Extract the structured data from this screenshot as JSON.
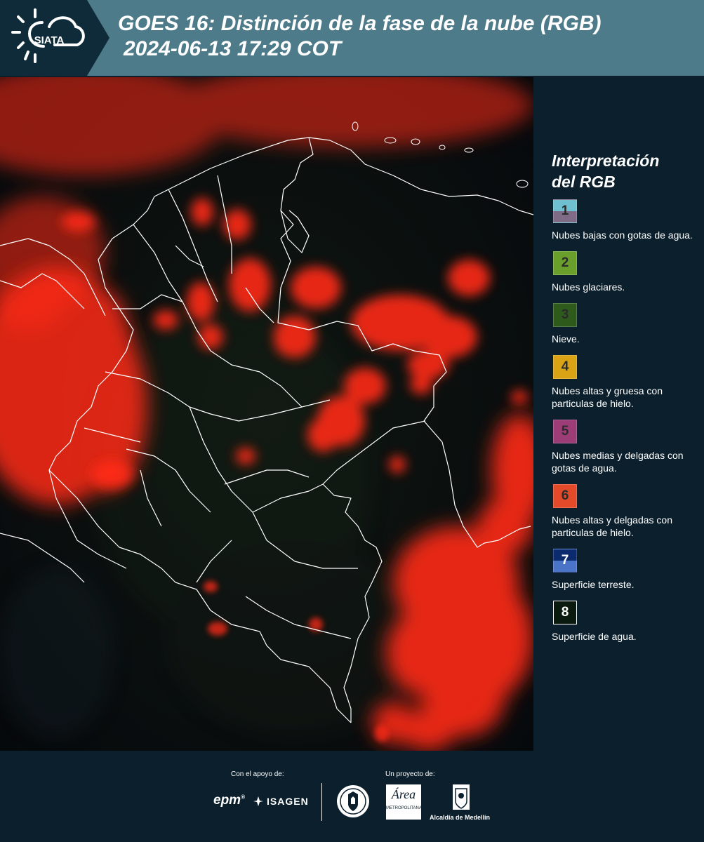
{
  "header": {
    "logo_text": "SIATA",
    "title_line1": "GOES 16: Distinción de la fase de la nube (RGB)",
    "title_line2": "2024-06-13 17:29 COT"
  },
  "legend": {
    "title_line1": "Interpretación",
    "title_line2": "del RGB",
    "items": [
      {
        "number": "1",
        "label": "Nubes bajas con gotas de agua.",
        "color_top": "#6ebfcf",
        "color_bottom": "#7f6b86"
      },
      {
        "number": "2",
        "label": "Nubes glaciares.",
        "color_top": "#6a9f2c",
        "color_bottom": "#6a9f2c"
      },
      {
        "number": "3",
        "label": "Nieve.",
        "color_top": "#2e5a1c",
        "color_bottom": "#2e5a1c"
      },
      {
        "number": "4",
        "label": "Nubes altas y gruesa con particulas de hielo.",
        "color_top": "#d9a315",
        "color_bottom": "#d9a315"
      },
      {
        "number": "5",
        "label": "Nubes medias y delgadas con gotas de agua.",
        "color_top": "#9c3d78",
        "color_bottom": "#9c3d78"
      },
      {
        "number": "6",
        "label": "Nubes altas y delgadas con particulas de hielo.",
        "color_top": "#e24a2a",
        "color_bottom": "#e24a2a"
      },
      {
        "number": "7",
        "label": "Superficie terreste.",
        "color_top": "#0c2a6e",
        "color_bottom": "#4a74c8"
      },
      {
        "number": "8",
        "label": "Superficie de agua.",
        "color_top": "#0a1a0e",
        "color_bottom": "#0a1a0e"
      }
    ]
  },
  "footer": {
    "support_label": "Con el apoyo de:",
    "project_label": "Un proyecto de:",
    "sponsor_epm": "epm",
    "sponsor_isagen": "ISAGEN",
    "metro_text": "Área",
    "metro_subtext": "METROPOLITANA",
    "alcaldia_text": "Alcaldía de Medellín"
  },
  "colors": {
    "header_bar": "#4e7b8a",
    "logo_panel": "#0f2a38",
    "page_background": "#0b1f2c",
    "cloud_red": "#ff2a18",
    "map_dark": "#070c10"
  }
}
